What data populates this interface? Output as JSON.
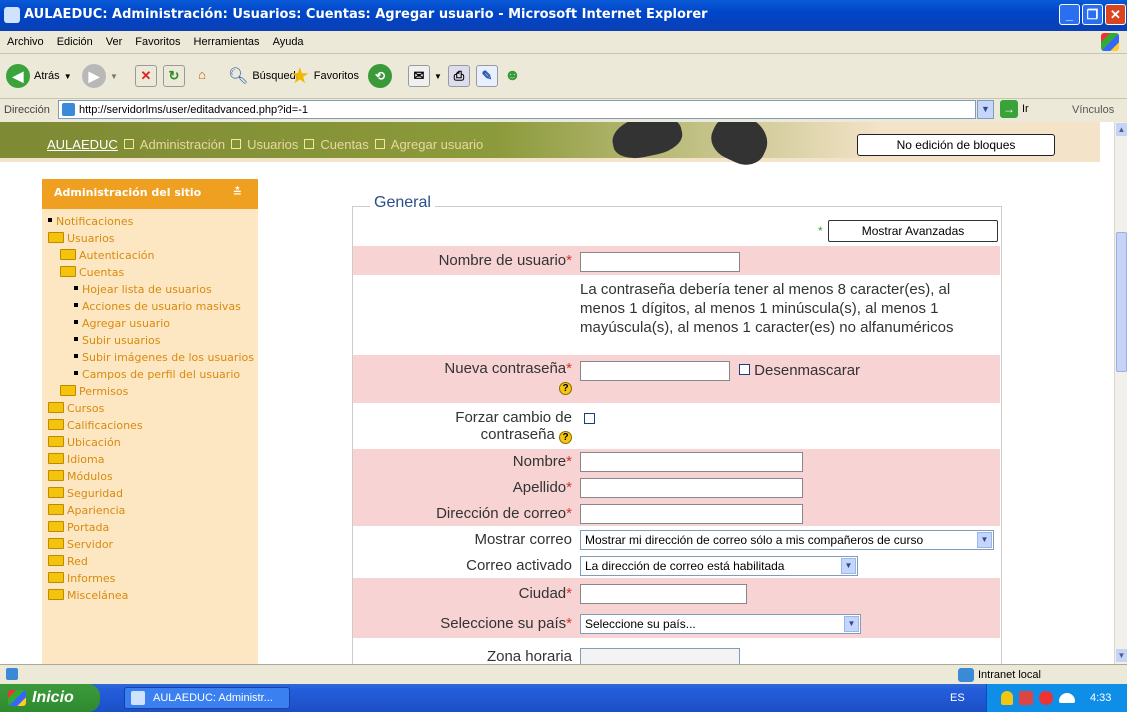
{
  "window": {
    "title": "AULAEDUC: Administración: Usuarios: Cuentas: Agregar usuario - Microsoft Internet Explorer"
  },
  "menubar": {
    "items": [
      "Archivo",
      "Edición",
      "Ver",
      "Favoritos",
      "Herramientas",
      "Ayuda"
    ]
  },
  "toolbar": {
    "back_label": "Atrás",
    "search_label": "Búsqueda",
    "favorites_label": "Favoritos"
  },
  "address": {
    "label": "Dirección",
    "url": "http://servidorlms/user/editadvanced.php?id=-1",
    "go_label": "Ir",
    "links_label": "Vínculos"
  },
  "breadcrumb": {
    "items": [
      "AULAEDUC",
      "Administración",
      "Usuarios",
      "Cuentas",
      "Agregar usuario"
    ]
  },
  "header": {
    "edit_blocks_button": "No edición de bloques"
  },
  "sidebar": {
    "title": "Administración del sitio",
    "toggle": "≛",
    "items": [
      {
        "label": "Notificaciones",
        "type": "bullet",
        "indent": 0
      },
      {
        "label": "Usuarios",
        "type": "folder",
        "indent": 0
      },
      {
        "label": "Autenticación",
        "type": "folder",
        "indent": 1
      },
      {
        "label": "Cuentas",
        "type": "folder",
        "indent": 1
      },
      {
        "label": "Hojear lista de usuarios",
        "type": "bullet",
        "indent": 2
      },
      {
        "label": "Acciones de usuario masivas",
        "type": "bullet",
        "indent": 2
      },
      {
        "label": "Agregar usuario",
        "type": "bullet",
        "indent": 2
      },
      {
        "label": "Subir usuarios",
        "type": "bullet",
        "indent": 2
      },
      {
        "label": "Subir imágenes de los usuarios",
        "type": "bullet",
        "indent": 2
      },
      {
        "label": "Campos de perfil del usuario",
        "type": "bullet",
        "indent": 2
      },
      {
        "label": "Permisos",
        "type": "folder",
        "indent": 1
      },
      {
        "label": "Cursos",
        "type": "folder",
        "indent": 0
      },
      {
        "label": "Calificaciones",
        "type": "folder",
        "indent": 0
      },
      {
        "label": "Ubicación",
        "type": "folder",
        "indent": 0
      },
      {
        "label": "Idioma",
        "type": "folder",
        "indent": 0
      },
      {
        "label": "Módulos",
        "type": "folder",
        "indent": 0
      },
      {
        "label": "Seguridad",
        "type": "folder",
        "indent": 0
      },
      {
        "label": "Apariencia",
        "type": "folder",
        "indent": 0
      },
      {
        "label": "Portada",
        "type": "folder",
        "indent": 0
      },
      {
        "label": "Servidor",
        "type": "folder",
        "indent": 0
      },
      {
        "label": "Red",
        "type": "folder",
        "indent": 0
      },
      {
        "label": "Informes",
        "type": "folder",
        "indent": 0
      },
      {
        "label": "Miscelánea",
        "type": "folder",
        "indent": 0
      }
    ]
  },
  "form": {
    "legend": "General",
    "show_advanced_button": "Mostrar Avanzadas",
    "username_label": "Nombre de usuario",
    "password_policy": "La contraseña debería tener al menos 8 caracter(es), al menos 1 dígitos, al menos 1 minúscula(s), al menos 1 mayúscula(s), al menos 1 caracter(es) no alfanuméricos",
    "new_password_label": "Nueva contraseña",
    "unmask_label": "Desenmascarar",
    "force_change_label_1": "Forzar cambio de",
    "force_change_label_2": "contraseña",
    "firstname_label": "Nombre",
    "lastname_label": "Apellido",
    "email_label": "Dirección de correo",
    "maildisplay_label": "Mostrar correo",
    "maildisplay_value": "Mostrar mi dirección de correo sólo a mis compañeros de curso",
    "emailstop_label": "Correo activado",
    "emailstop_value": "La dirección de correo está habilitada",
    "city_label": "Ciudad",
    "country_label": "Seleccione su país",
    "country_value": "Seleccione su país...",
    "timezone_label": "Zona horaria",
    "required_marker": "*"
  },
  "statusbar": {
    "zone": "Intranet local"
  },
  "taskbar": {
    "start": "Inicio",
    "task_item": "AULAEDUC: Administr...",
    "lang": "ES",
    "clock": "4:33"
  }
}
